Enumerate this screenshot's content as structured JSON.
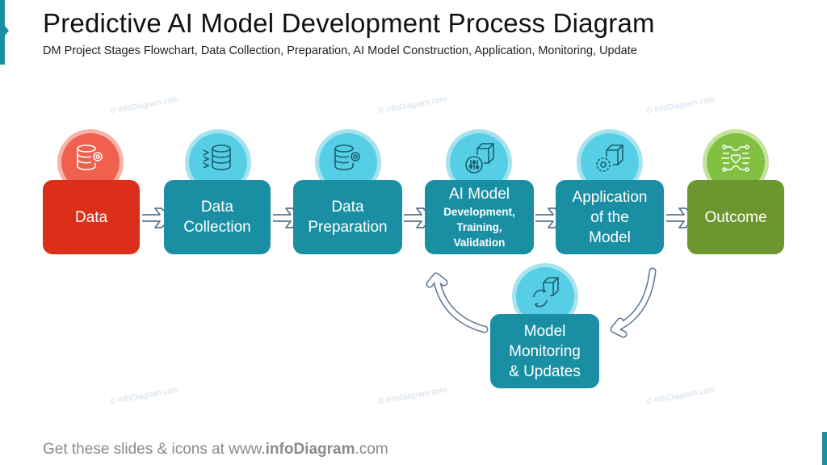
{
  "header": {
    "title": "Predictive AI Model Development Process Diagram",
    "subtitle": "DM Project Stages Flowchart, Data Collection, Preparation, AI Model Construction, Application, Monitoring, Update"
  },
  "stages": [
    {
      "id": "data",
      "lines": [
        "Data"
      ],
      "icon": "database-gear-icon",
      "color": "#dc2f1a"
    },
    {
      "id": "data-collection",
      "lines": [
        "Data",
        "Collection"
      ],
      "icon": "database-inflow-icon",
      "color": "#1a8fa4"
    },
    {
      "id": "data-preparation",
      "lines": [
        "Data",
        "Preparation"
      ],
      "icon": "database-gear-icon",
      "color": "#1a8fa4"
    },
    {
      "id": "ai-model",
      "lines": [
        "AI Model"
      ],
      "sublines": [
        "Development,",
        "Training,",
        "Validation"
      ],
      "icon": "cube-sliders-icon",
      "color": "#1a8fa4"
    },
    {
      "id": "application",
      "lines": [
        "Application",
        "of the",
        "Model"
      ],
      "icon": "cube-gear-icon",
      "color": "#1a8fa4"
    },
    {
      "id": "outcome",
      "lines": [
        "Outcome"
      ],
      "icon": "circuit-heart-icon",
      "color": "#6b9630"
    },
    {
      "id": "monitoring",
      "lines": [
        "Model",
        "Monitoring",
        "& Updates"
      ],
      "icon": "cube-refresh-icon",
      "color": "#1a8fa4"
    }
  ],
  "watermark": "© infoDiagram.com",
  "footer": {
    "prefix": "Get these slides & icons at www.",
    "brand": "infoDiagram",
    "suffix": ".com"
  },
  "colors": {
    "accent": "#1a8fa4",
    "red": "#dc2f1a",
    "green": "#6b9630",
    "arrow_outline": "#5a7590"
  }
}
